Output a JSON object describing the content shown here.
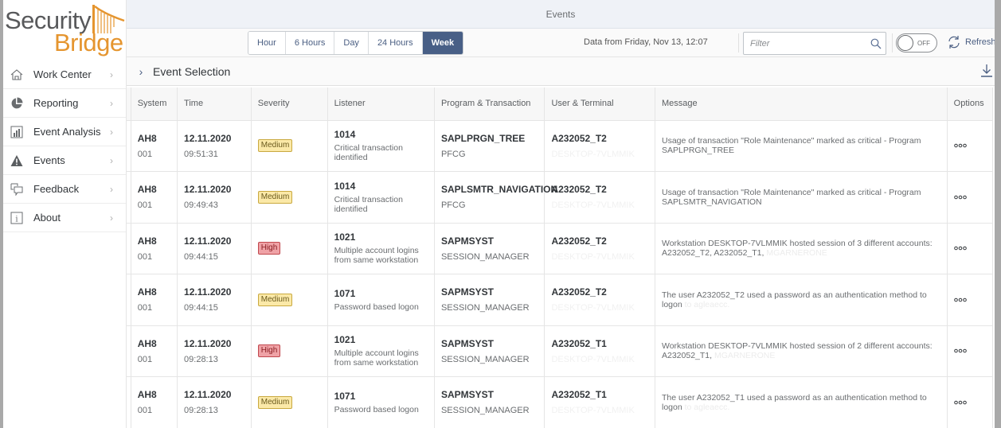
{
  "logo": {
    "line1": "Security",
    "line2": "Bridge"
  },
  "sidebar": {
    "items": [
      {
        "label": "Work Center",
        "icon": "home-icon"
      },
      {
        "label": "Reporting",
        "icon": "pie-chart-icon"
      },
      {
        "label": "Event Analysis",
        "icon": "bar-chart-icon"
      },
      {
        "label": "Events",
        "icon": "warning-icon"
      },
      {
        "label": "Feedback",
        "icon": "feedback-icon"
      },
      {
        "label": "About",
        "icon": "info-icon"
      }
    ]
  },
  "header": {
    "title": "Events"
  },
  "toolbar": {
    "ranges": [
      "Hour",
      "6 Hours",
      "Day",
      "24 Hours",
      "Week"
    ],
    "active_range": "Week",
    "data_from": "Data from Friday, Nov 13, 12:07",
    "filter_placeholder": "Filter",
    "filter_value": "",
    "toggle_label": "OFF",
    "refresh_label": "Refresh"
  },
  "selection": {
    "title": "Event Selection"
  },
  "table": {
    "columns": [
      "System",
      "Time",
      "Severity",
      "Listener",
      "Program & Transaction",
      "User & Terminal",
      "Message",
      "Options"
    ],
    "rows": [
      {
        "system": "AH8",
        "client": "001",
        "date": "12.11.2020",
        "time": "09:51:31",
        "severity": "Medium",
        "listener_id": "1014",
        "listener_desc": "Critical transaction identified",
        "program": "SAPLPRGN_TREE",
        "transaction": "PFCG",
        "user": "A232052_T2",
        "terminal": "DESKTOP-7VLMMIK",
        "message": "Usage of transaction \"Role Maintenance\" marked as critical - Program SAPLPRGN_TREE",
        "message_faded": ""
      },
      {
        "system": "AH8",
        "client": "001",
        "date": "12.11.2020",
        "time": "09:49:43",
        "severity": "Medium",
        "listener_id": "1014",
        "listener_desc": "Critical transaction identified",
        "program": "SAPLSMTR_NAVIGATION",
        "transaction": "PFCG",
        "user": "A232052_T2",
        "terminal": "DESKTOP-7VLMMIK",
        "message": "Usage of transaction \"Role Maintenance\" marked as critical - Program SAPLSMTR_NAVIGATION",
        "message_faded": ""
      },
      {
        "system": "AH8",
        "client": "001",
        "date": "12.11.2020",
        "time": "09:44:15",
        "severity": "High",
        "listener_id": "1021",
        "listener_desc": "Multiple account logins from same workstation",
        "program": "SAPMSYST",
        "transaction": "SESSION_MANAGER",
        "user": "A232052_T2",
        "terminal": "DESKTOP-7VLMMIK",
        "message": "Workstation DESKTOP-7VLMMIK hosted session of 3 different accounts: A232052_T2, A232052_T1, ",
        "message_faded": "MGARNERONE"
      },
      {
        "system": "AH8",
        "client": "001",
        "date": "12.11.2020",
        "time": "09:44:15",
        "severity": "Medium",
        "listener_id": "1071",
        "listener_desc": "Password based logon",
        "program": "SAPMSYST",
        "transaction": "SESSION_MANAGER",
        "user": "A232052_T2",
        "terminal": "DESKTOP-7VLMMIK",
        "message": "The user A232052_T2 used a password as an authentication method to logon ",
        "message_faded": "to agleaecc."
      },
      {
        "system": "AH8",
        "client": "001",
        "date": "12.11.2020",
        "time": "09:28:13",
        "severity": "High",
        "listener_id": "1021",
        "listener_desc": "Multiple account logins from same workstation",
        "program": "SAPMSYST",
        "transaction": "SESSION_MANAGER",
        "user": "A232052_T1",
        "terminal": "DESKTOP-7VLMMIK",
        "message": "Workstation DESKTOP-7VLMMIK hosted session of 2 different accounts: A232052_T1, ",
        "message_faded": "MGARNERONE"
      },
      {
        "system": "AH8",
        "client": "001",
        "date": "12.11.2020",
        "time": "09:28:13",
        "severity": "Medium",
        "listener_id": "1071",
        "listener_desc": "Password based logon",
        "program": "SAPMSYST",
        "transaction": "SESSION_MANAGER",
        "user": "A232052_T1",
        "terminal": "DESKTOP-7VLMMIK",
        "message": "The user A232052_T1 used a password as an authentication method to logon ",
        "message_faded": "to agleaecc."
      }
    ],
    "options_glyph": "ooo"
  },
  "colors": {
    "brand_gray": "#58595b",
    "brand_orange": "#e5952f",
    "active_segment": "#485f86",
    "medium_badge": "#fbe9a8",
    "high_badge": "#efa2a6"
  }
}
